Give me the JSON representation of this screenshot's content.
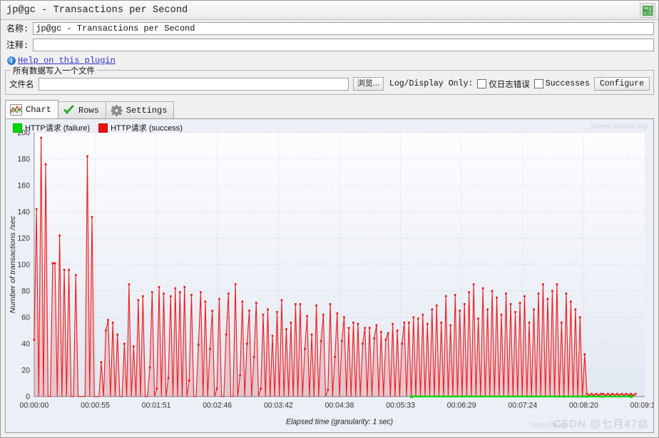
{
  "window": {
    "title": "jp@gc - Transactions per Second",
    "plugin_icon": "puzzle-icon"
  },
  "form": {
    "name_label": "名称:",
    "name_value": "jp@gc - Transactions per Second",
    "comment_label": "注释:",
    "comment_value": "",
    "help_link": "Help on this plugin",
    "info_icon": "info-icon"
  },
  "file_panel": {
    "title": "所有数据写入一个文件",
    "filename_label": "文件名",
    "filename_value": "",
    "browse_label": "浏览...",
    "log_display_label": "Log/Display Only:",
    "errors_checkbox": {
      "label": "仅日志错误",
      "checked": false
    },
    "successes_checkbox": {
      "label": "Successes",
      "checked": false
    },
    "configure_label": "Configure"
  },
  "tabs": [
    {
      "label": "Chart",
      "icon": "line-chart-icon",
      "active": true
    },
    {
      "label": "Rows",
      "icon": "green-check-icon",
      "active": false
    },
    {
      "label": "Settings",
      "icon": "gear-icon",
      "active": false
    }
  ],
  "chart_watermark": "jmeter-plugins.org",
  "page_watermark": "CSDN @七月47丝",
  "page_watermark_url": "https://blog.",
  "chart_data": {
    "type": "line",
    "title": "",
    "xlabel": "Elapsed time (granularity: 1 sec)",
    "ylabel": "Number of transactions /sec",
    "ylim": [
      0,
      200
    ],
    "ytick_step": 20,
    "yticks": [
      0,
      20,
      40,
      60,
      80,
      100,
      120,
      140,
      160,
      180,
      200
    ],
    "xticks": [
      "00:00:00",
      "00:00:55",
      "00:01:51",
      "00:02:46",
      "00:03:42",
      "00:04:38",
      "00:05:33",
      "00:06:29",
      "00:07:24",
      "00:08:20",
      "00:09:16"
    ],
    "grid": true,
    "legend_position": "top-left",
    "series": [
      {
        "name": "HTTP请求 (failure)",
        "color": "#00d800",
        "comment": "flat at zero from ~00:05:36 to end",
        "x_start_frac": 0.618,
        "x_end_frac": 0.978,
        "values": [
          0,
          0
        ]
      },
      {
        "name": "HTTP请求 (success)",
        "color": "#ee1111",
        "comment": "per-second transaction rate, strongly oscillating sawtooth",
        "values": [
          43,
          142,
          0,
          196,
          0,
          176,
          0,
          0,
          101,
          101,
          0,
          122,
          0,
          96,
          0,
          96,
          0,
          0,
          92,
          0,
          0,
          0,
          0,
          182,
          0,
          136,
          0,
          0,
          0,
          26,
          0,
          50,
          58,
          0,
          56,
          0,
          47,
          0,
          0,
          40,
          0,
          85,
          0,
          38,
          0,
          73,
          0,
          76,
          0,
          0,
          22,
          79,
          0,
          6,
          83,
          0,
          78,
          0,
          14,
          76,
          0,
          82,
          0,
          79,
          0,
          83,
          0,
          12,
          77,
          0,
          0,
          39,
          79,
          0,
          72,
          0,
          36,
          65,
          0,
          6,
          74,
          0,
          0,
          47,
          78,
          0,
          0,
          85,
          0,
          16,
          72,
          0,
          40,
          65,
          0,
          30,
          71,
          0,
          6,
          62,
          0,
          66,
          0,
          46,
          0,
          64,
          0,
          73,
          0,
          51,
          0,
          56,
          0,
          70,
          0,
          70,
          0,
          36,
          61,
          0,
          47,
          0,
          69,
          0,
          42,
          62,
          0,
          5,
          70,
          0,
          30,
          63,
          0,
          42,
          60,
          0,
          52,
          0,
          56,
          0,
          55,
          0,
          40,
          52,
          0,
          52,
          0,
          44,
          54,
          0,
          49,
          0,
          43,
          48,
          0,
          55,
          0,
          50,
          0,
          40,
          56,
          0,
          56,
          0,
          60,
          0,
          59,
          0,
          62,
          0,
          55,
          0,
          66,
          0,
          69,
          0,
          56,
          0,
          76,
          0,
          54,
          0,
          77,
          0,
          65,
          0,
          70,
          0,
          79,
          0,
          85,
          0,
          59,
          0,
          82,
          0,
          66,
          0,
          80,
          0,
          75,
          0,
          62,
          0,
          78,
          0,
          70,
          0,
          64,
          0,
          71,
          0,
          76,
          0,
          56,
          0,
          66,
          0,
          78,
          0,
          85,
          0,
          74,
          0,
          80,
          0,
          85,
          0,
          56,
          0,
          78,
          0,
          72,
          0,
          66,
          0,
          60,
          0,
          32,
          2,
          1,
          2,
          1,
          2,
          1,
          2,
          2,
          1,
          2,
          1,
          2,
          1,
          2,
          1,
          2,
          1,
          2,
          1,
          2,
          1,
          2
        ]
      }
    ]
  }
}
